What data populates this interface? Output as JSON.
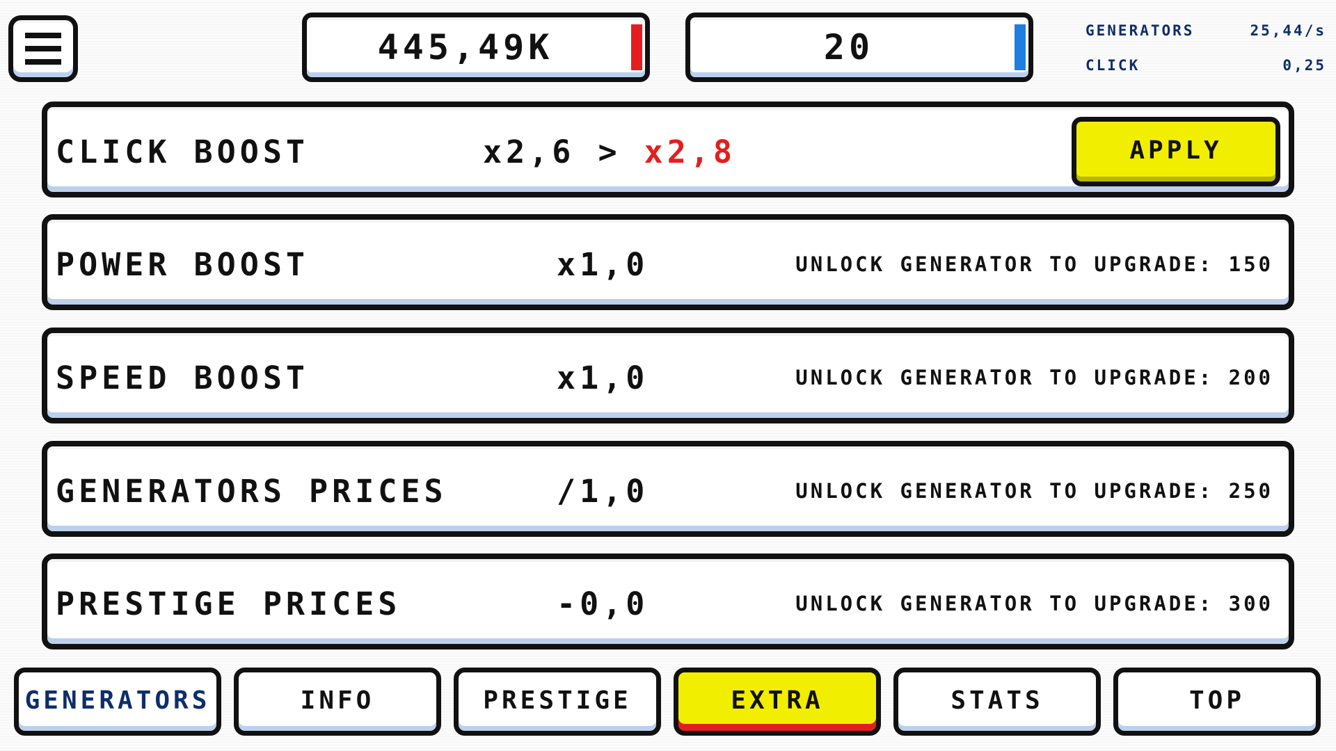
{
  "top_bar": {
    "currency": "445,49K",
    "prestige_points": "20",
    "stats": [
      {
        "label": "GENERATORS",
        "value": "25,44/s"
      },
      {
        "label": "CLICK",
        "value": "0,25"
      }
    ]
  },
  "upgrades": [
    {
      "name": "CLICK BOOST",
      "current": "x2,6 >",
      "next": "x2,8",
      "action": "APPLY"
    },
    {
      "name": "POWER BOOST",
      "value": "x1,0",
      "unlock_text": "UNLOCK GENERATOR TO UPGRADE: 150"
    },
    {
      "name": "SPEED BOOST",
      "value": "x1,0",
      "unlock_text": "UNLOCK GENERATOR TO UPGRADE: 200"
    },
    {
      "name": "GENERATORS PRICES",
      "value": "/1,0",
      "unlock_text": "UNLOCK GENERATOR TO UPGRADE: 250"
    },
    {
      "name": "PRESTIGE PRICES",
      "value": "-0,0",
      "unlock_text": "UNLOCK GENERATOR TO UPGRADE: 300"
    }
  ],
  "nav": {
    "active": "EXTRA",
    "tabs": [
      "GENERATORS",
      "INFO",
      "PRESTIGE",
      "EXTRA",
      "STATS",
      "TOP"
    ]
  },
  "colors": {
    "accent_yellow": "#f2ee00",
    "accent_red": "#e41e1e",
    "accent_blue": "#1e7ee4",
    "text_dark": "#111111",
    "stat_blue": "#0d2e6b"
  },
  "icons": {
    "menu": "hamburger-menu-icon"
  }
}
